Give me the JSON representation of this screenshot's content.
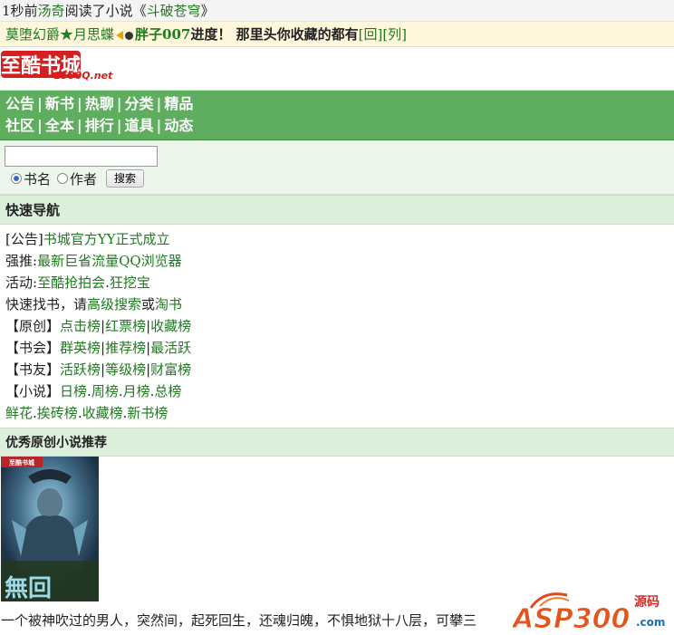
{
  "activity": {
    "prefix": "1秒前",
    "user": "汤奇",
    "action": "阅读了小说《",
    "book": "斗破苍穹",
    "suffix": "》"
  },
  "ticker": {
    "user1": "莫堕幻爵",
    "star": "★",
    "user2": "月思蝶",
    "user3": "胖子007",
    "message": "进度！ 那里头你收藏的都有",
    "reply": "[回]",
    "list": "[列]"
  },
  "logo": {
    "main": "至酷书城",
    "sub": "2580Q.net"
  },
  "nav": {
    "row1": [
      "公告",
      "新书",
      "热聊",
      "分类",
      "精品"
    ],
    "row2": [
      "社区",
      "全本",
      "排行",
      "道具",
      "动态"
    ]
  },
  "search": {
    "value": "",
    "option1": "书名",
    "option2": "作者",
    "button": "搜索"
  },
  "quicknav": {
    "title": "快速导航",
    "notice_label": "[公告]",
    "notice_link": "书城官方YY正式成立",
    "recommend_label": "强推:",
    "recommend_link": "最新巨省流量QQ浏览器",
    "event_label": "活动:",
    "event_links": [
      "至酷抢拍会",
      "狂挖宝"
    ],
    "find_text": "快速找书，请",
    "find_links": [
      "高级搜索",
      "淘书"
    ],
    "find_join": "或",
    "rows": [
      {
        "label": "【原创】",
        "links": [
          "点击榜",
          "红票榜",
          "收藏榜"
        ],
        "sep": "|"
      },
      {
        "label": "【书会】",
        "links": [
          "群英榜",
          "推荐榜",
          "最活跃"
        ],
        "sep": "|"
      },
      {
        "label": "【书友】",
        "links": [
          "活跃榜",
          "等级榜",
          "财富榜"
        ],
        "sep": "|"
      },
      {
        "label": "【小说】",
        "links": [
          "日榜",
          "周榜",
          "月榜",
          "总榜"
        ],
        "sep": "."
      }
    ],
    "last_row": [
      "鲜花",
      "挨砖榜",
      "收藏榜",
      "新书榜"
    ]
  },
  "featured": {
    "title": "优秀原创小说推荐",
    "cover_title": "無回",
    "cover_badge": "至酷书城",
    "description": "一个被神吹过的男人，突然间，起死回生，还魂归魄，不惧地狱十八层，可攀三"
  },
  "watermark": {
    "brand": "ASP300",
    "tag": "源码",
    "domain": ".com"
  },
  "colors": {
    "link": "#1f7a1f",
    "nav_bg": "#5fae5f",
    "section_bg": "#dcefdc",
    "ticker_bg": "#fff7dc"
  }
}
